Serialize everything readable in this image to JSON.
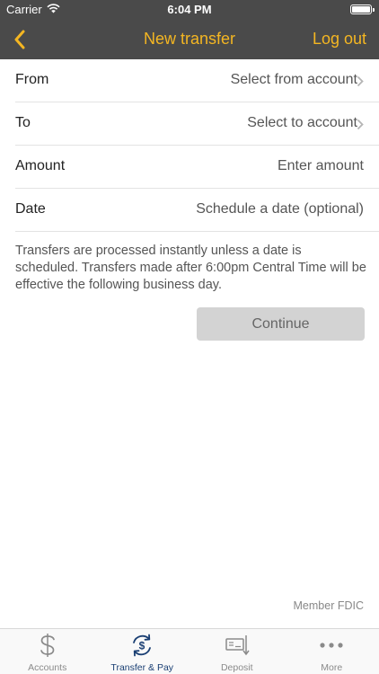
{
  "status_bar": {
    "carrier": "Carrier",
    "time": "6:04 PM"
  },
  "nav": {
    "title": "New transfer",
    "right_label": "Log out"
  },
  "form": {
    "rows": [
      {
        "label": "From",
        "value": "Select from account"
      },
      {
        "label": "To",
        "value": "Select to account"
      },
      {
        "label": "Amount",
        "value": "Enter amount"
      },
      {
        "label": "Date",
        "value": "Schedule a date (optional)"
      }
    ]
  },
  "notice": "Transfers are processed instantly unless a date is scheduled. Transfers made after 6:00pm Central Time will be effective the following business day.",
  "continue_label": "Continue",
  "footer_note": "Member FDIC",
  "tabs": [
    {
      "label": "Accounts",
      "icon": "dollar-icon"
    },
    {
      "label": "Transfer & Pay",
      "icon": "transfer-pay-icon"
    },
    {
      "label": "Deposit",
      "icon": "check-deposit-icon"
    },
    {
      "label": "More",
      "icon": "more-icon"
    }
  ],
  "colors": {
    "header_bg": "#4a4a4a",
    "accent": "#f4b622",
    "active_tab": "#1a3f73",
    "button_bg": "#d3d3d3"
  }
}
